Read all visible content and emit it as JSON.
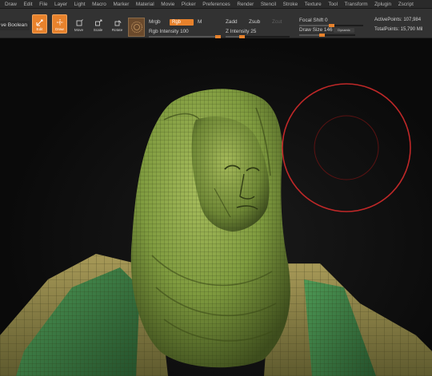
{
  "menu": [
    "Draw",
    "Edit",
    "File",
    "Layer",
    "Light",
    "Macro",
    "Marker",
    "Material",
    "Movie",
    "Picker",
    "Preferences",
    "Render",
    "Stencil",
    "Stroke",
    "Texture",
    "Tool",
    "Transform",
    "Zplugin",
    "Zscript"
  ],
  "shelf": {
    "live_boolean": "ve Boolean",
    "edit": "Edit",
    "draw": "Draw",
    "move": "Move",
    "scale": "Scale",
    "rotate": "Rotate",
    "mrgb": "Mrgb",
    "rgb": "Rgb",
    "m": "M",
    "rgb_intensity": "Rgb Intensity 100",
    "zadd": "Zadd",
    "zsub": "Zsub",
    "zcut": "Zcut",
    "z_intensity": "Z Intensity 25",
    "focal_shift": "Focal Shift 0",
    "draw_size": "Draw Size 146",
    "dynamic": "Dynamic",
    "active_points": "ActivePoints: 107,984",
    "total_points": "TotalPoints: 15,790 Mil"
  },
  "sliders": {
    "rgb_intensity_fraction": 1.0,
    "z_intensity_fraction": 0.25,
    "focal_shift_fraction": 0.5,
    "draw_size_fraction": 0.4
  },
  "colors": {
    "accent": "#e8822c",
    "mesh": "#8aa64a",
    "cloth": "#3f8a4a",
    "brush_ring": "#c02828"
  },
  "icons": {
    "edit": "edit-icon",
    "draw": "draw-icon",
    "move": "move-icon",
    "scale": "scale-icon",
    "rotate": "rotate-icon",
    "material": "material-icon"
  }
}
